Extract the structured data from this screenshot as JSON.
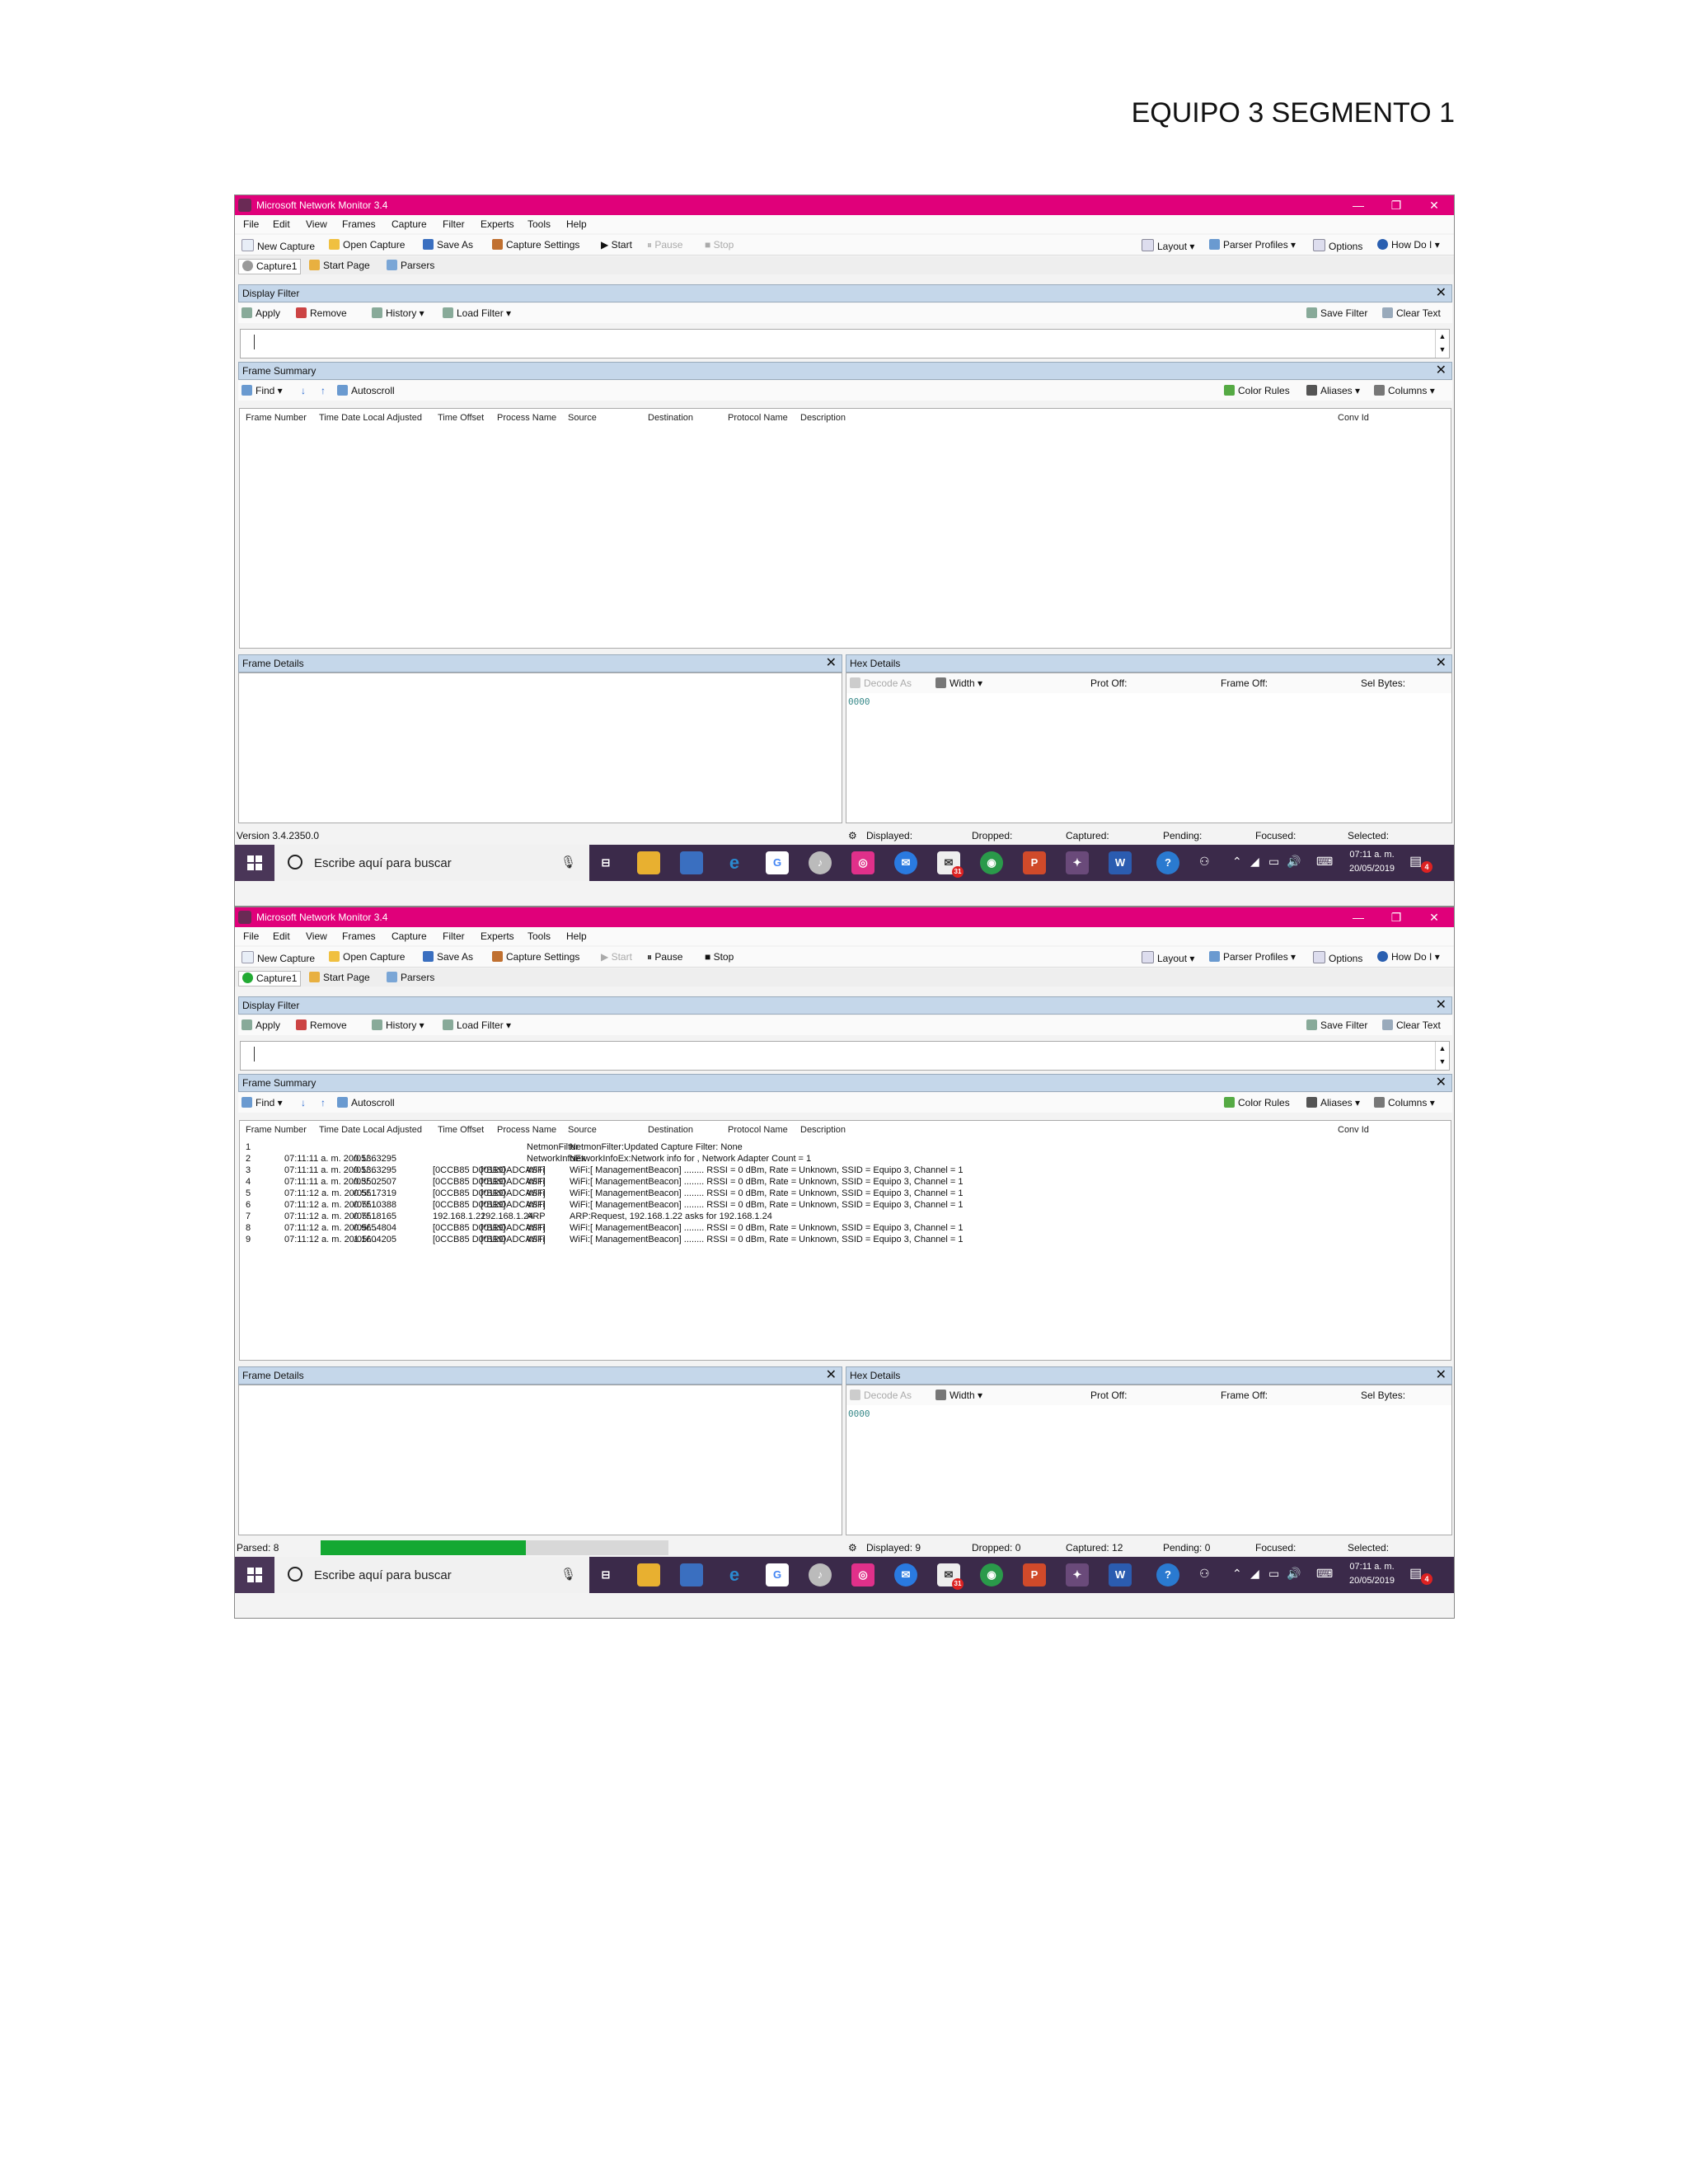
{
  "document": {
    "title": "EQUIPO 3 SEGMENTO 1"
  },
  "window": {
    "title": "Microsoft Network Monitor 3.4",
    "controls": {
      "minimize": "—",
      "restore": "❐",
      "close": "✕"
    }
  },
  "menu": [
    "File",
    "Edit",
    "View",
    "Frames",
    "Capture",
    "Filter",
    "Experts",
    "Tools",
    "Help"
  ],
  "toolbar": {
    "new_capture": "New Capture",
    "open_capture": "Open Capture",
    "save_as": "Save As",
    "capture_settings": "Capture Settings",
    "start": "Start",
    "pause": "Pause",
    "stop": "Stop",
    "layout": "Layout",
    "parser_profiles": "Parser Profiles",
    "options": "Options",
    "how_do_i": "How Do I"
  },
  "tabs": {
    "capture": "Capture1",
    "start_page": "Start Page",
    "parsers": "Parsers"
  },
  "display_filter": {
    "title": "Display Filter",
    "apply": "Apply",
    "remove": "Remove",
    "history": "History",
    "load_filter": "Load Filter",
    "save_filter": "Save Filter",
    "clear_text": "Clear Text"
  },
  "frame_summary": {
    "title": "Frame Summary",
    "find": "Find",
    "autoscroll": "Autoscroll",
    "color_rules": "Color Rules",
    "aliases": "Aliases",
    "columns_btn": "Columns",
    "columns": [
      "Frame Number",
      "Time Date Local Adjusted",
      "Time Offset",
      "Process Name",
      "Source",
      "Destination",
      "Protocol Name",
      "Description",
      "Conv Id"
    ]
  },
  "frame_details": {
    "title": "Frame Details"
  },
  "hex_details": {
    "title": "Hex Details",
    "decode_as": "Decode As",
    "width": "Width",
    "prot_off": "Prot Off:",
    "frame_off": "Frame Off:",
    "sel_bytes": "Sel Bytes:",
    "offset": "0000"
  },
  "status_labels": {
    "displayed": "Displayed:",
    "dropped": "Dropped:",
    "captured": "Captured:",
    "pending": "Pending:",
    "focused": "Focused:",
    "selected": "Selected:"
  },
  "taskbar": {
    "search_placeholder": "Escribe aquí para buscar",
    "time": "07:11 a. m.",
    "date": "20/05/2019",
    "mail_badge": "31",
    "notif_badge": "4"
  },
  "capture1": {
    "version": "Version 3.4.2350.0",
    "status": {
      "displayed": "",
      "dropped": "",
      "captured": "",
      "pending": ""
    },
    "rows": []
  },
  "capture2": {
    "parsed": "Parsed: 8",
    "parsed_progress": 0.59,
    "status": {
      "displayed": "Displayed: 9",
      "dropped": "Dropped: 0",
      "captured": "Captured: 12",
      "pending": "Pending: 0"
    },
    "rows": [
      {
        "num": "1",
        "time": "",
        "offset": "",
        "source": "",
        "dest": "",
        "proto": "NetmonFilter",
        "desc": "NetmonFilter:Updated Capture Filter: None"
      },
      {
        "num": "2",
        "time": "07:11:11 a. m. 20/05/...",
        "offset": "0.1363295",
        "source": "",
        "dest": "",
        "proto": "NetworkInfoEx",
        "desc": "NetworkInfoEx:Network info for , Network Adapter Count = 1"
      },
      {
        "num": "3",
        "time": "07:11:11 a. m. 20/05/...",
        "offset": "0.1363295",
        "source": "[0CCB85 D00119]",
        "dest": "[*BROADCAST]",
        "proto": "WiFi",
        "desc": "WiFi:[ ManagementBeacon] ........ RSSI = 0 dBm, Rate = Unknown, SSID = Equipo 3, Channel = 1"
      },
      {
        "num": "4",
        "time": "07:11:11 a. m. 20/05/...",
        "offset": "0.3502507",
        "source": "[0CCB85 D00119]",
        "dest": "[*BROADCAST]",
        "proto": "WiFi",
        "desc": "WiFi:[ ManagementBeacon] ........ RSSI = 0 dBm, Rate = Unknown, SSID = Equipo 3, Channel = 1"
      },
      {
        "num": "5",
        "time": "07:11:12 a. m. 20/05/...",
        "offset": "0.5517319",
        "source": "[0CCB85 D00119]",
        "dest": "[*BROADCAST]",
        "proto": "WiFi",
        "desc": "WiFi:[ ManagementBeacon] ........ RSSI = 0 dBm, Rate = Unknown, SSID = Equipo 3, Channel = 1"
      },
      {
        "num": "6",
        "time": "07:11:12 a. m. 20/05/...",
        "offset": "0.7510388",
        "source": "[0CCB85 D00119]",
        "dest": "[*BROADCAST]",
        "proto": "WiFi",
        "desc": "WiFi:[ ManagementBeacon] ........ RSSI = 0 dBm, Rate = Unknown, SSID = Equipo 3, Channel = 1"
      },
      {
        "num": "7",
        "time": "07:11:12 a. m. 20/05/...",
        "offset": "0.7518165",
        "source": "192.168.1.22",
        "dest": "192.168.1.24",
        "proto": "ARP",
        "desc": "ARP:Request, 192.168.1.22 asks for 192.168.1.24"
      },
      {
        "num": "8",
        "time": "07:11:12 a. m. 20/05/...",
        "offset": "0.9654804",
        "source": "[0CCB85 D00119]",
        "dest": "[*BROADCAST]",
        "proto": "WiFi",
        "desc": "WiFi:[ ManagementBeacon] ........ RSSI = 0 dBm, Rate = Unknown, SSID = Equipo 3, Channel = 1"
      },
      {
        "num": "9",
        "time": "07:11:12 a. m. 20/05/...",
        "offset": "1.1604205",
        "source": "[0CCB85 D00119]",
        "dest": "[*BROADCAST]",
        "proto": "WiFi",
        "desc": "WiFi:[ ManagementBeacon] ........ RSSI = 0 dBm, Rate = Unknown, SSID = Equipo 3, Channel = 1"
      }
    ]
  },
  "colors": {
    "titlebar": "#e0007a",
    "panel_header": "#c5d7ea",
    "progress": "#14a832",
    "taskbar": "#3b2a4a"
  }
}
